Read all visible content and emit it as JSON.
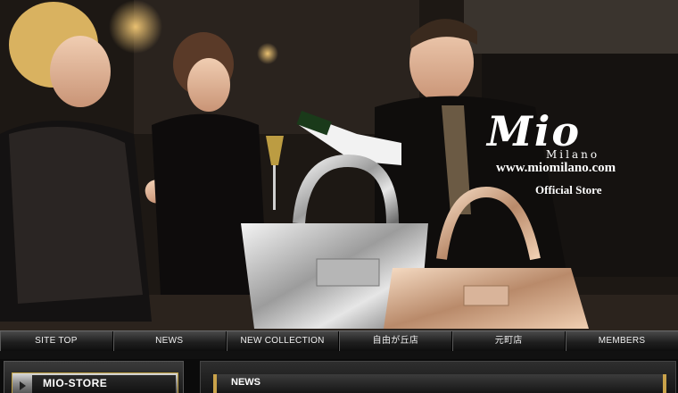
{
  "brand": {
    "logo": "Mio",
    "sub": "Milano",
    "url": "www.miomilano.com",
    "store_label": "Official Store"
  },
  "nav": {
    "items": [
      {
        "label": "SITE TOP"
      },
      {
        "label": "NEWS"
      },
      {
        "label": "NEW COLLECTION"
      },
      {
        "label": "自由が丘店"
      },
      {
        "label": "元町店"
      },
      {
        "label": "MEMBERS"
      }
    ]
  },
  "sidebar": {
    "title": "MIO-STORE"
  },
  "main": {
    "news_title": "NEWS"
  },
  "colors": {
    "accent_gold": "#c9a24a",
    "text": "#ffffff",
    "background": "#0b0b0b"
  }
}
